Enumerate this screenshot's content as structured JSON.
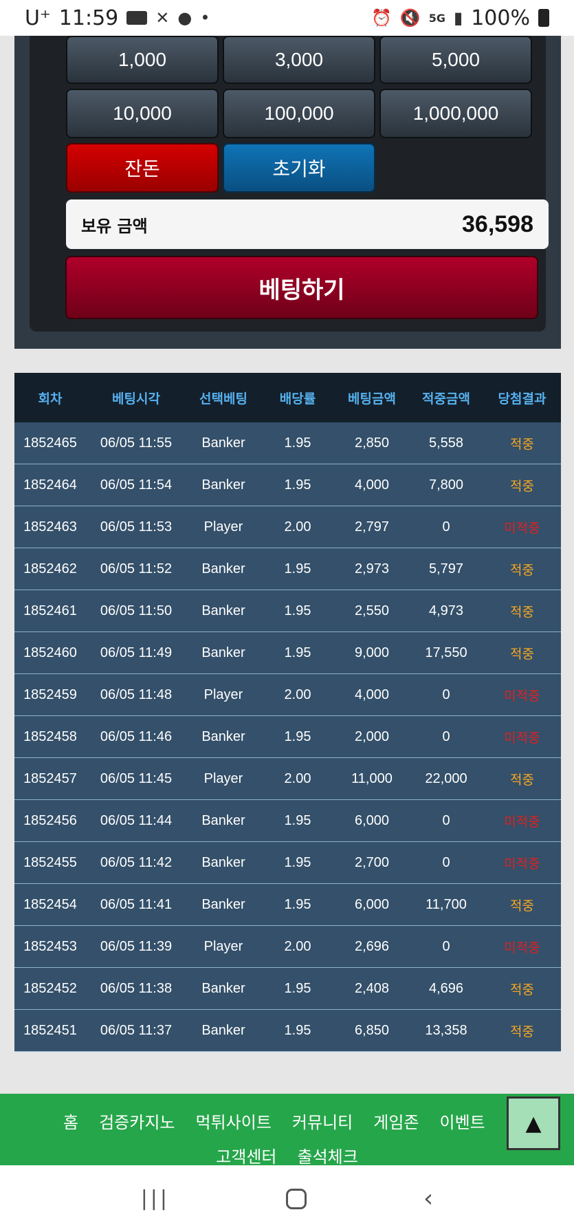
{
  "status_bar": {
    "carrier": "U⁺",
    "time": "11:59",
    "signal_label": "5G",
    "battery": "100%"
  },
  "panel": {
    "amount_buttons": [
      [
        "1,000",
        "3,000",
        "5,000"
      ],
      [
        "10,000",
        "100,000",
        "1,000,000"
      ]
    ],
    "change_label": "잔돈",
    "reset_label": "초기화",
    "balance_label": "보유 금액",
    "balance_value": "36,598",
    "bet_label": "베팅하기"
  },
  "table": {
    "headers": [
      "회차",
      "베팅시각",
      "선택베팅",
      "배당률",
      "베팅금액",
      "적중금액",
      "당첨결과"
    ],
    "rows": [
      [
        "1852465",
        "06/05 11:55",
        "Banker",
        "1.95",
        "2,850",
        "5,558",
        "적중"
      ],
      [
        "1852464",
        "06/05 11:54",
        "Banker",
        "1.95",
        "4,000",
        "7,800",
        "적중"
      ],
      [
        "1852463",
        "06/05 11:53",
        "Player",
        "2.00",
        "2,797",
        "0",
        "미적중"
      ],
      [
        "1852462",
        "06/05 11:52",
        "Banker",
        "1.95",
        "2,973",
        "5,797",
        "적중"
      ],
      [
        "1852461",
        "06/05 11:50",
        "Banker",
        "1.95",
        "2,550",
        "4,973",
        "적중"
      ],
      [
        "1852460",
        "06/05 11:49",
        "Banker",
        "1.95",
        "9,000",
        "17,550",
        "적중"
      ],
      [
        "1852459",
        "06/05 11:48",
        "Player",
        "2.00",
        "4,000",
        "0",
        "미적중"
      ],
      [
        "1852458",
        "06/05 11:46",
        "Banker",
        "1.95",
        "2,000",
        "0",
        "미적중"
      ],
      [
        "1852457",
        "06/05 11:45",
        "Player",
        "2.00",
        "11,000",
        "22,000",
        "적중"
      ],
      [
        "1852456",
        "06/05 11:44",
        "Banker",
        "1.95",
        "6,000",
        "0",
        "미적중"
      ],
      [
        "1852455",
        "06/05 11:42",
        "Banker",
        "1.95",
        "2,700",
        "0",
        "미적중"
      ],
      [
        "1852454",
        "06/05 11:41",
        "Banker",
        "1.95",
        "6,000",
        "11,700",
        "적중"
      ],
      [
        "1852453",
        "06/05 11:39",
        "Player",
        "2.00",
        "2,696",
        "0",
        "미적중"
      ],
      [
        "1852452",
        "06/05 11:38",
        "Banker",
        "1.95",
        "2,408",
        "4,696",
        "적중"
      ],
      [
        "1852451",
        "06/05 11:37",
        "Banker",
        "1.95",
        "6,850",
        "13,358",
        "적중"
      ]
    ],
    "win_color": "#f5a623",
    "lose_color": "#e02020"
  },
  "footer_nav": {
    "line1": [
      "홈",
      "검증카지노",
      "먹튀사이트",
      "커뮤니티",
      "게임존",
      "이벤트"
    ],
    "line2": [
      "고객센터",
      "출석체크"
    ]
  },
  "scroll_top_icon": "arrow-up-icon"
}
